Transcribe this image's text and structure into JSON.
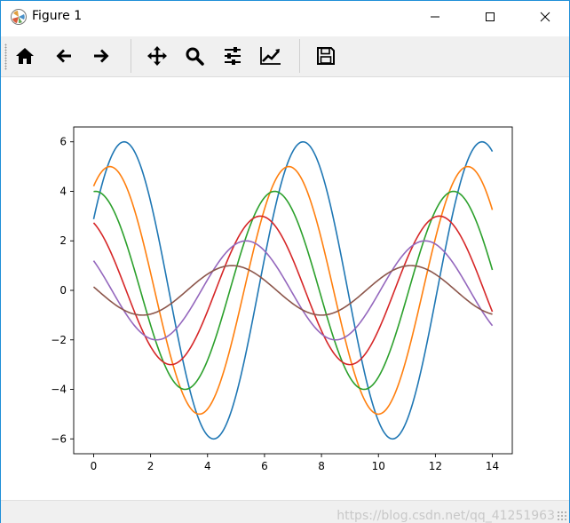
{
  "window": {
    "title": "Figure 1",
    "controls": [
      "minimize-icon",
      "maximize-icon",
      "close-icon"
    ]
  },
  "toolbar": {
    "buttons": [
      {
        "name": "home-button",
        "icon": "home-icon"
      },
      {
        "name": "back-button",
        "icon": "arrow-left-icon"
      },
      {
        "name": "forward-button",
        "icon": "arrow-right-icon"
      },
      {
        "name": "pan-button",
        "icon": "move-icon"
      },
      {
        "name": "zoom-button",
        "icon": "magnifier-icon"
      },
      {
        "name": "configure-subplots-button",
        "icon": "sliders-icon"
      },
      {
        "name": "edit-axes-button",
        "icon": "line-chart-icon"
      },
      {
        "name": "save-button",
        "icon": "floppy-disk-icon"
      }
    ]
  },
  "watermark": "https://blog.csdn.net/qq_41251963",
  "chart_data": {
    "type": "line",
    "title": "",
    "xlabel": "",
    "ylabel": "",
    "xlim": [
      -0.7,
      14.7
    ],
    "ylim": [
      -6.6,
      6.6
    ],
    "xticks": [
      "0",
      "2",
      "4",
      "6",
      "8",
      "10",
      "12",
      "14"
    ],
    "yticks": [
      "−6",
      "−4",
      "−2",
      "0",
      "2",
      "4",
      "6"
    ],
    "grid": false,
    "legend": "none",
    "x": [
      0,
      14
    ],
    "series": [
      {
        "formula": "6*sin(x+0.5)",
        "color": "#1f77b4"
      },
      {
        "formula": "5*sin(x+1)",
        "color": "#ff7f0e"
      },
      {
        "formula": "4*sin(x+1.5)",
        "color": "#2ca02c"
      },
      {
        "formula": "3*sin(x+2)",
        "color": "#d62728"
      },
      {
        "formula": "2*sin(x+2.5)",
        "color": "#9467bd"
      },
      {
        "formula": "1*sin(x+3)",
        "color": "#8c564b"
      }
    ]
  }
}
